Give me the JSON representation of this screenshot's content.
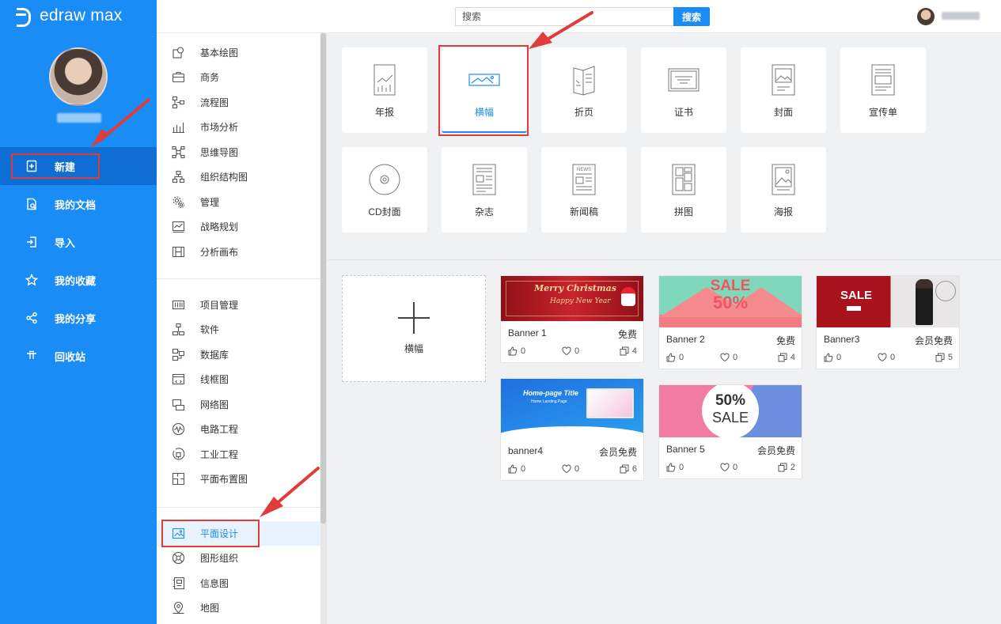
{
  "app": {
    "logo_text": "edraw max"
  },
  "sidebar": {
    "items": [
      {
        "label": "新建",
        "icon": "new-file-icon"
      },
      {
        "label": "我的文档",
        "icon": "my-documents-icon"
      },
      {
        "label": "导入",
        "icon": "import-icon"
      },
      {
        "label": "我的收藏",
        "icon": "star-icon"
      },
      {
        "label": "我的分享",
        "icon": "share-icon"
      },
      {
        "label": "回收站",
        "icon": "recycle-bin-icon"
      }
    ],
    "active_index": 0
  },
  "topbar": {
    "search_placeholder": "搜索",
    "search_button": "搜索"
  },
  "categories": {
    "group1": [
      "基本绘图",
      "商务",
      "流程图",
      "市场分析",
      "思维导图",
      "组织结构图",
      "管理",
      "战略规划",
      "分析画布"
    ],
    "group2": [
      "项目管理",
      "软件",
      "数据库",
      "线框图",
      "网络图",
      "电路工程",
      "工业工程",
      "平面布置图"
    ],
    "group3": [
      "平面设计",
      "图形组织",
      "信息图",
      "地图"
    ],
    "active": "平面设计"
  },
  "types": [
    {
      "label": "年报",
      "icon": "annual-report-icon"
    },
    {
      "label": "横幅",
      "icon": "banner-icon"
    },
    {
      "label": "折页",
      "icon": "brochure-icon"
    },
    {
      "label": "证书",
      "icon": "certificate-icon"
    },
    {
      "label": "封面",
      "icon": "cover-icon"
    },
    {
      "label": "宣传单",
      "icon": "flyer-icon"
    },
    {
      "label": "CD封面",
      "icon": "cd-cover-icon"
    },
    {
      "label": "杂志",
      "icon": "magazine-icon"
    },
    {
      "label": "新闻稿",
      "icon": "news-icon"
    },
    {
      "label": "拼图",
      "icon": "collage-icon"
    },
    {
      "label": "海报",
      "icon": "poster-icon"
    }
  ],
  "new_blank": {
    "label": "横幅"
  },
  "templates": [
    {
      "name": "Banner 1",
      "price": "免费",
      "likes": "0",
      "favorites": "0",
      "copies": "4",
      "thumb_title": "Merry Christmas",
      "thumb_sub": "Happy New Year"
    },
    {
      "name": "Banner 2",
      "price": "免费",
      "likes": "0",
      "favorites": "0",
      "copies": "4",
      "thumb_title": "SALE",
      "thumb_sub": "50%"
    },
    {
      "name": "Banner3",
      "price": "会员免费",
      "likes": "0",
      "favorites": "0",
      "copies": "5",
      "thumb_title": "SALE",
      "thumb_sub": ""
    },
    {
      "name": "banner4",
      "price": "会员免费",
      "likes": "0",
      "favorites": "0",
      "copies": "6",
      "thumb_title": "Home-page Title",
      "thumb_sub": "Home Landing Page"
    },
    {
      "name": "Banner 5",
      "price": "会员免费",
      "likes": "0",
      "favorites": "0",
      "copies": "2",
      "thumb_title": "50%",
      "thumb_sub": "SALE"
    }
  ],
  "colors": {
    "brand": "#1a8cf5",
    "sidebar_active": "#0f6ed3",
    "annotation": "#e03c3c"
  }
}
